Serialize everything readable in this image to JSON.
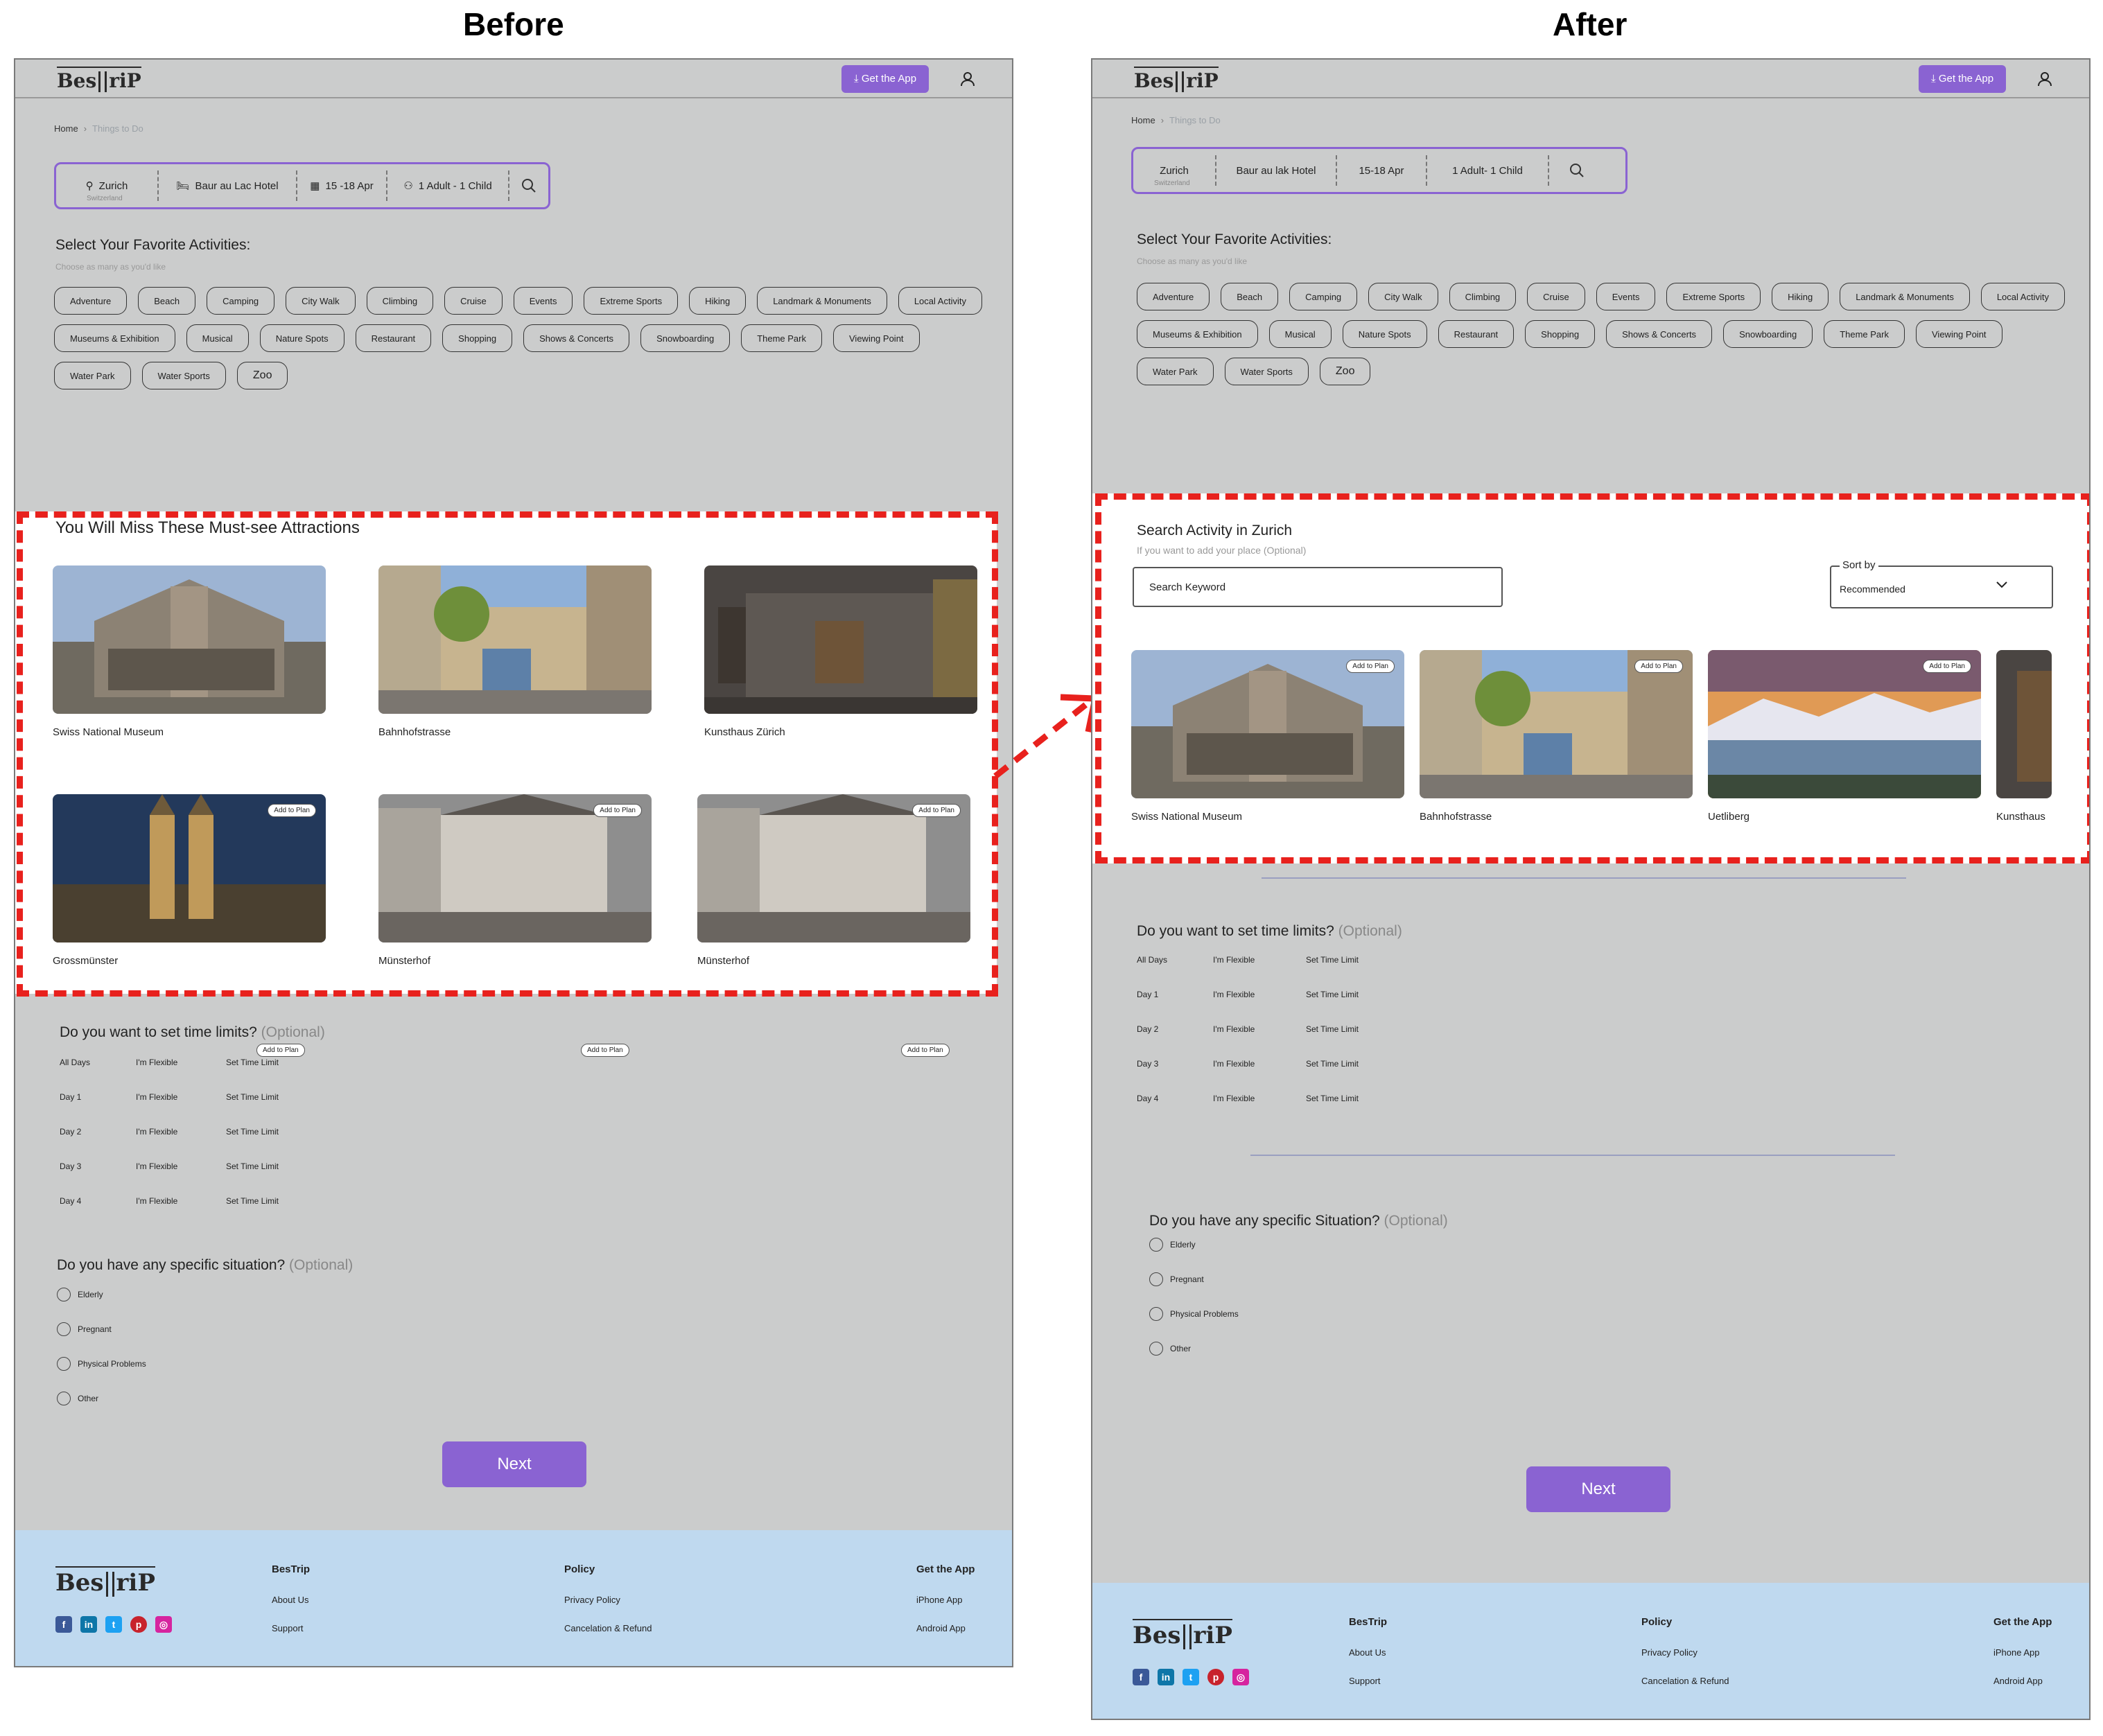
{
  "headings": {
    "before": "Before",
    "after": "After"
  },
  "brand": {
    "logo_left": "Bes",
    "logo_right": "riP",
    "get_app": "Get the App"
  },
  "breadcrumb": {
    "home": "Home",
    "current": "Things to Do"
  },
  "before": {
    "search": {
      "city": "Zurich",
      "country": "Switzerland",
      "hotel": "Baur au Lac Hotel",
      "dates": "15 -18 Apr",
      "guests": "1 Adult - 1 Child"
    },
    "must_see_title": "You Will Miss These Must-see Attractions",
    "attractions": [
      "Swiss National Museum",
      "Bahnhofstrasse",
      "Kunsthaus Zürich",
      "Grossmünster",
      "Münsterhof",
      "Münsterhof"
    ]
  },
  "after": {
    "search": {
      "city": "Zurich",
      "country": "Switzerland",
      "hotel": "Baur au lak Hotel",
      "dates": "15-18 Apr",
      "guests": "1 Adult- 1 Child"
    },
    "search_activity_title": "Search Activity in Zurich",
    "search_activity_sub": "If you want to add your place (Optional)",
    "search_placeholder": "Search Keyword",
    "sort_label": "Sort by",
    "sort_value": "Recommended",
    "attractions": [
      "Swiss National Museum",
      "Bahnhofstrasse",
      "Uetliberg",
      "Kunsthaus"
    ]
  },
  "activities": {
    "title": "Select Your Favorite Activities:",
    "subtitle": "Choose as many as you'd like",
    "chips": [
      "Adventure",
      "Beach",
      "Camping",
      "City Walk",
      "Climbing",
      "Cruise",
      "Events",
      "Extreme Sports",
      "Hiking",
      "Landmark & Monuments",
      "Local Activity",
      "Museums & Exhibition",
      "Musical",
      "Nature Spots",
      "Restaurant",
      "Shopping",
      "Shows & Concerts",
      "Snowboarding",
      "Theme Park",
      "Viewing Point",
      "Water Park",
      "Water Sports",
      "Zoo"
    ]
  },
  "add_to_plan": "Add to Plan",
  "time_limits": {
    "title": "Do you want to set time limits?",
    "optional": "(Optional)",
    "rows": [
      "All Days",
      "Day 1",
      "Day 2",
      "Day 3",
      "Day 4"
    ],
    "flexible": "I'm Flexible",
    "set_limit": "Set Time Limit"
  },
  "situation": {
    "title_before": "Do you have any specific situation?",
    "title_after": "Do you have any specific Situation?",
    "optional": "(Optional)",
    "options": [
      "Elderly",
      "Pregnant",
      "Physical Problems",
      "Other"
    ]
  },
  "next": "Next",
  "footer": {
    "col1": {
      "title": "BesTrip",
      "links": [
        "About Us",
        "Support"
      ]
    },
    "col2": {
      "title": "Policy",
      "links": [
        "Privacy Policy",
        "Cancelation & Refund"
      ]
    },
    "col3": {
      "title": "Get the App",
      "links": [
        "iPhone App",
        "Android App"
      ]
    }
  },
  "colors": {
    "accent": "#8a63d2",
    "highlight": "#e8211d",
    "footer": "#bfd9ef",
    "frame": "#cbcccc"
  }
}
